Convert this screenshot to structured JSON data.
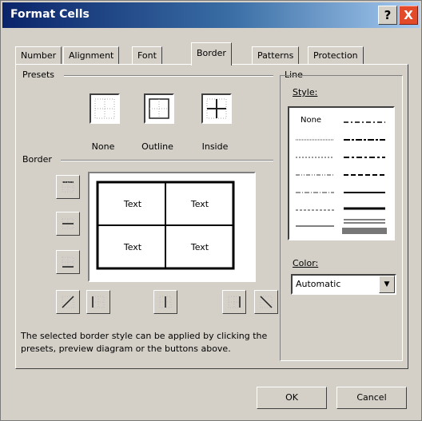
{
  "window": {
    "title": "Format Cells",
    "help_icon": "?",
    "close_icon": "X"
  },
  "tabs": [
    {
      "label": "Number"
    },
    {
      "label": "Alignment"
    },
    {
      "label": "Font"
    },
    {
      "label": "Border",
      "active": true
    },
    {
      "label": "Patterns"
    },
    {
      "label": "Protection"
    }
  ],
  "presets": {
    "group_label": "Presets",
    "none_label": "None",
    "outline_label": "Outline",
    "inside_label": "Inside"
  },
  "border": {
    "group_label": "Border",
    "preview_cells": [
      "Text",
      "Text",
      "Text",
      "Text"
    ]
  },
  "line": {
    "group_label": "Line",
    "style_label": "Style:",
    "style_none_label": "None",
    "color_label": "Color:",
    "color_value": "Automatic"
  },
  "note": "The selected border style can be applied by clicking the presets, preview diagram or the buttons above.",
  "buttons": {
    "ok_label": "OK",
    "cancel_label": "Cancel"
  }
}
